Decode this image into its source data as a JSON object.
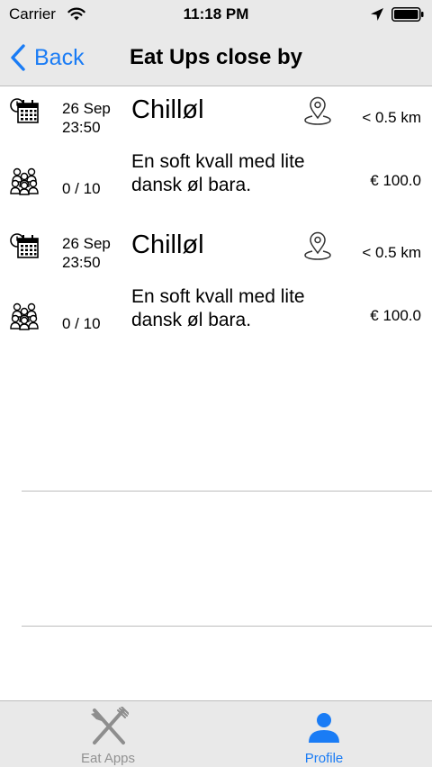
{
  "status_bar": {
    "carrier": "Carrier",
    "time": "11:18 PM"
  },
  "nav": {
    "back_label": "Back",
    "title": "Eat Ups close by"
  },
  "events": [
    {
      "date": "26 Sep",
      "time": "23:50",
      "title": "Chilløl",
      "distance": "< 0.5 km",
      "capacity": "0 / 10",
      "description": "En soft kvall med lite dansk øl bara.",
      "price": "€ 100.0"
    },
    {
      "date": "26 Sep",
      "time": "23:50",
      "title": "Chilløl",
      "distance": "< 0.5 km",
      "capacity": "0 / 10",
      "description": "En soft kvall med lite dansk øl bara.",
      "price": "€ 100.0"
    }
  ],
  "tabs": [
    {
      "label": "Eat Apps",
      "icon": "fork-knife-icon",
      "active": false
    },
    {
      "label": "Profile",
      "icon": "person-icon",
      "active": true
    }
  ],
  "colors": {
    "accent": "#1a7cf5",
    "bar_background": "#e9e9e9",
    "inactive_tab": "#929292"
  }
}
